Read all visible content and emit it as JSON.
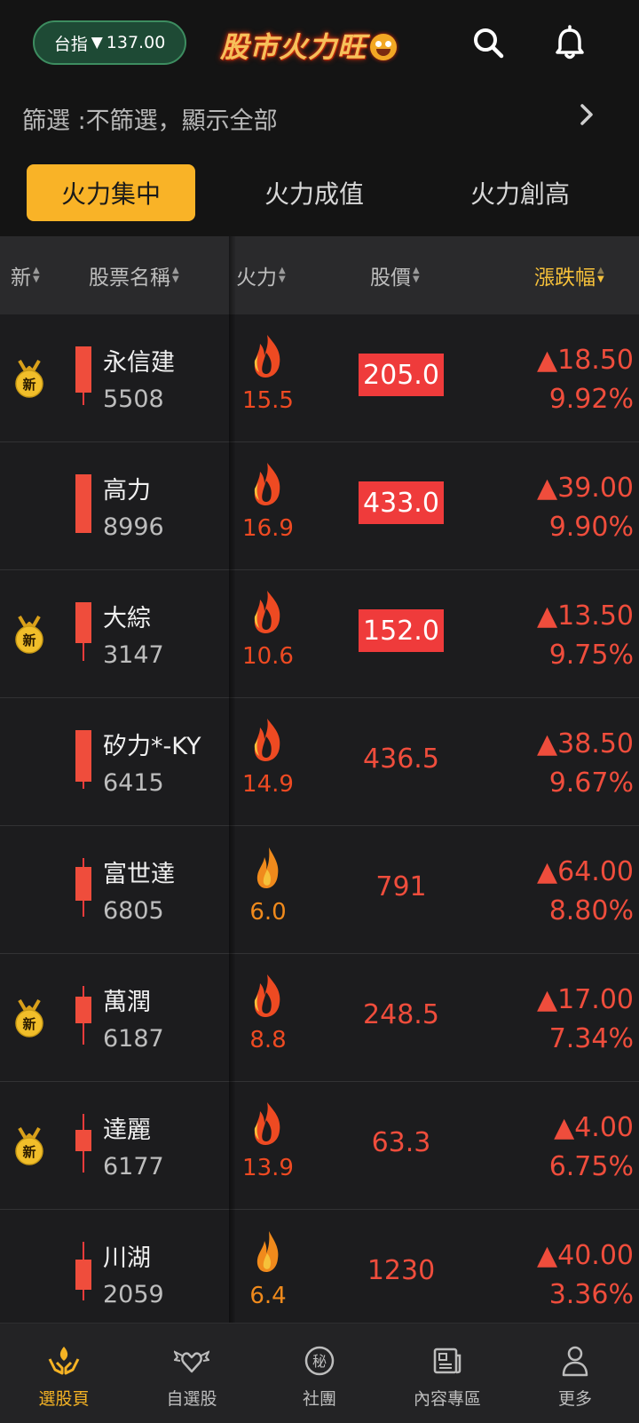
{
  "header": {
    "index_label": "台指",
    "index_arrow": "▼",
    "index_value": "137.00",
    "app_title": "股市火力旺",
    "search_icon": "search-icon",
    "bell_icon": "bell-icon"
  },
  "filter": {
    "text": "篩選 :不篩選，顯示全部"
  },
  "tabs": [
    {
      "label": "火力集中",
      "active": true
    },
    {
      "label": "火力成值",
      "active": false
    },
    {
      "label": "火力創高",
      "active": false
    }
  ],
  "columns": [
    {
      "label": "新"
    },
    {
      "label": "股票名稱"
    },
    {
      "label": "火力"
    },
    {
      "label": "股價"
    },
    {
      "label": "漲跌幅",
      "active": true
    }
  ],
  "new_badge_label": "新",
  "rows": [
    {
      "is_new": true,
      "name": "永信建",
      "code": "5508",
      "fire": "15.5",
      "price": "205.0",
      "boxed": true,
      "change": "▲18.50",
      "pct": "9.92%"
    },
    {
      "is_new": false,
      "name": "高力",
      "code": "8996",
      "fire": "16.9",
      "price": "433.0",
      "boxed": true,
      "change": "▲39.00",
      "pct": "9.90%"
    },
    {
      "is_new": true,
      "name": "大綜",
      "code": "3147",
      "fire": "10.6",
      "price": "152.0",
      "boxed": true,
      "change": "▲13.50",
      "pct": "9.75%"
    },
    {
      "is_new": false,
      "name": "矽力*-KY",
      "code": "6415",
      "fire": "14.9",
      "price": "436.5",
      "boxed": false,
      "change": "▲38.50",
      "pct": "9.67%"
    },
    {
      "is_new": false,
      "name": "富世達",
      "code": "6805",
      "fire": "6.0",
      "price": "791",
      "boxed": false,
      "change": "▲64.00",
      "pct": "8.80%"
    },
    {
      "is_new": true,
      "name": "萬潤",
      "code": "6187",
      "fire": "8.8",
      "price": "248.5",
      "boxed": false,
      "change": "▲17.00",
      "pct": "7.34%"
    },
    {
      "is_new": true,
      "name": "達麗",
      "code": "6177",
      "fire": "13.9",
      "price": "63.3",
      "boxed": false,
      "change": "▲4.00",
      "pct": "6.75%"
    },
    {
      "is_new": false,
      "name": "川湖",
      "code": "2059",
      "fire": "6.4",
      "price": "1230",
      "boxed": false,
      "change": "▲40.00",
      "pct": "3.36%"
    }
  ],
  "nav": [
    {
      "label": "選股頁",
      "icon": "hands-flame-icon",
      "active": true
    },
    {
      "label": "自選股",
      "icon": "winged-heart-icon",
      "active": false
    },
    {
      "label": "社團",
      "icon": "secret-circle-icon",
      "glyph": "秘",
      "active": false
    },
    {
      "label": "內容專區",
      "icon": "news-icon",
      "active": false
    },
    {
      "label": "更多",
      "icon": "person-icon",
      "active": false
    }
  ],
  "colors": {
    "up": "#ef4d3c",
    "accent": "#f9b327",
    "fire_hi": "#ee4a22",
    "fire_lo": "#f08a1c"
  }
}
